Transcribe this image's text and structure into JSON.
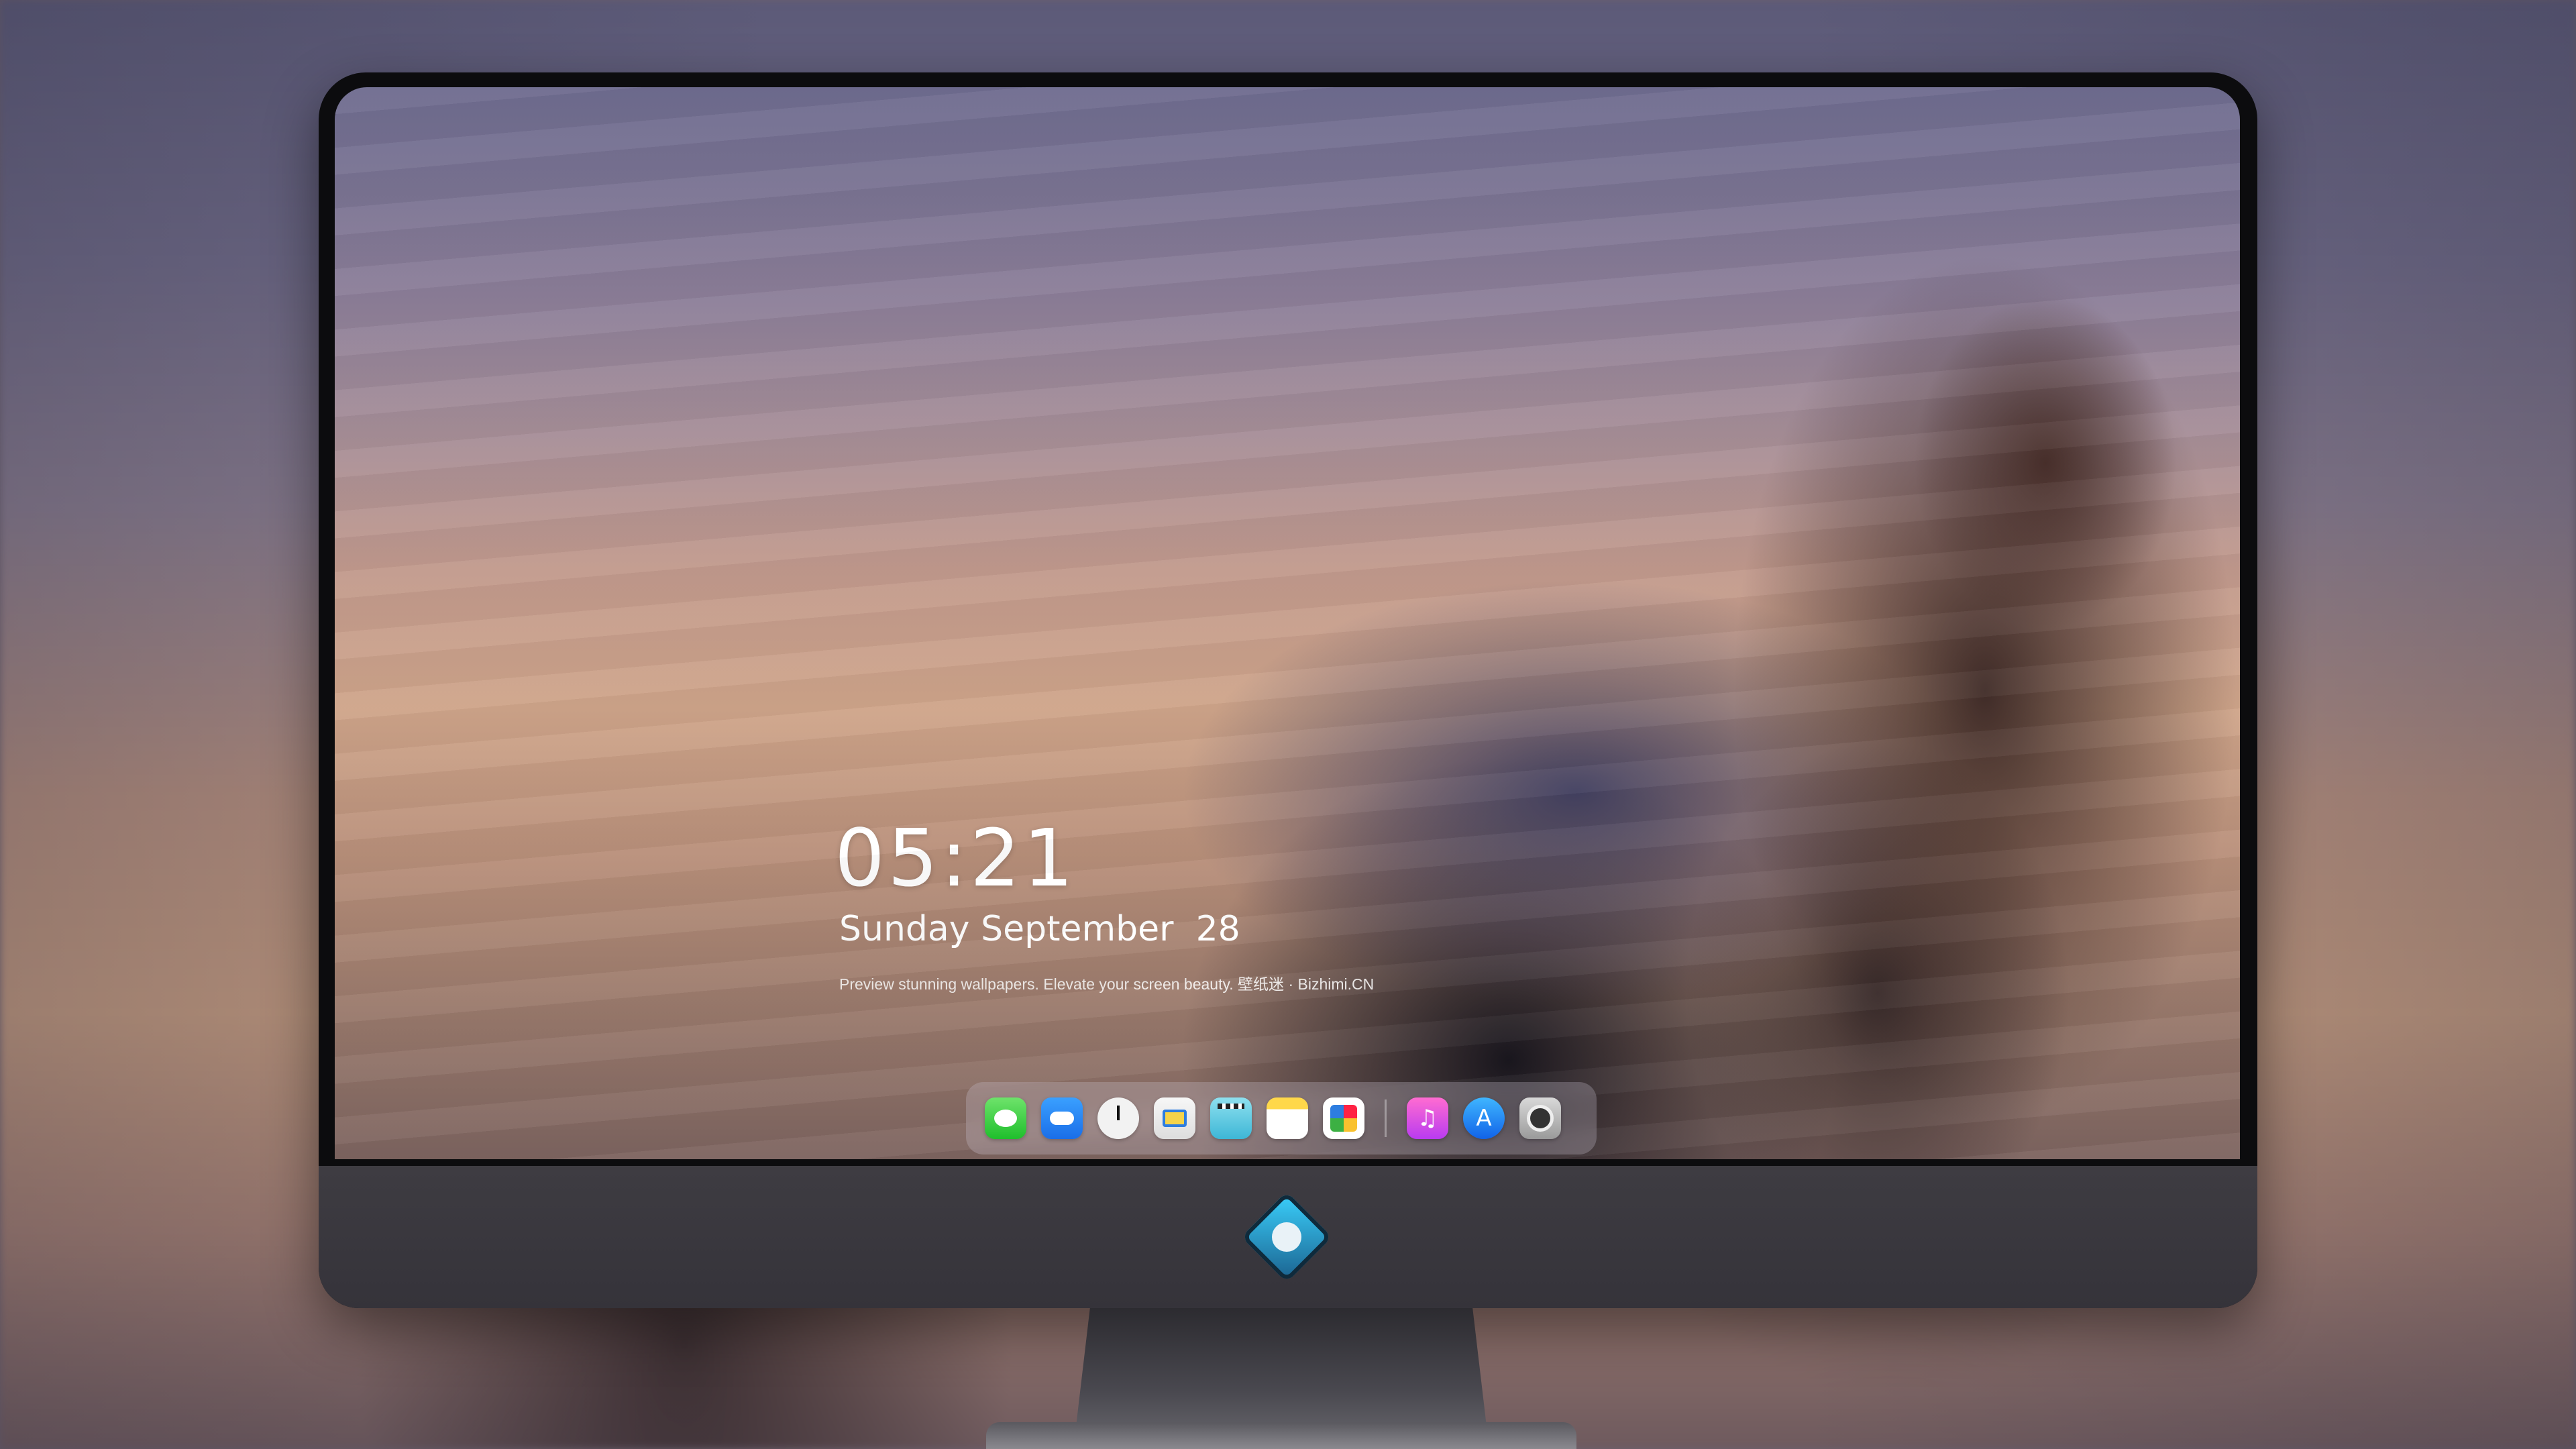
{
  "lockscreen": {
    "time": "05:21",
    "date": "Sunday September  28",
    "tagline": "Preview stunning wallpapers. Elevate your screen beauty. 壁纸迷 · Bizhimi.CN"
  },
  "dock": {
    "apps": [
      {
        "name": "Messages",
        "icon": "messages-icon"
      },
      {
        "name": "Weather",
        "icon": "weather-icon"
      },
      {
        "name": "Clock",
        "icon": "clock-icon"
      },
      {
        "name": "Preview",
        "icon": "preview-icon"
      },
      {
        "name": "Clips",
        "icon": "clips-icon"
      },
      {
        "name": "Notes",
        "icon": "notes-icon"
      },
      {
        "name": "Photos",
        "icon": "photos-icon"
      },
      {
        "name": "Music",
        "icon": "music-icon",
        "glyph": "♫"
      },
      {
        "name": "App Store",
        "icon": "app-store-icon",
        "glyph": "A"
      },
      {
        "name": "Camera",
        "icon": "camera-icon"
      }
    ]
  },
  "monitor": {
    "logo": "bizhimi-logo-icon"
  }
}
